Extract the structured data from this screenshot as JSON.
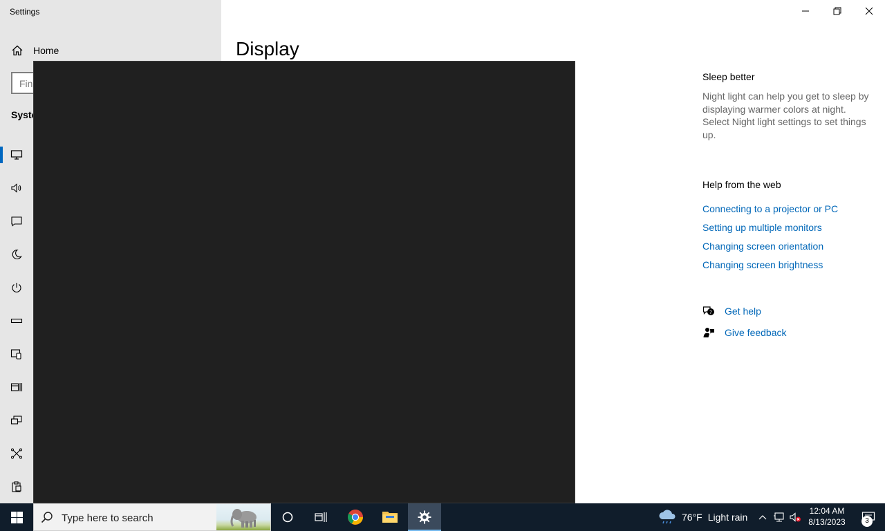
{
  "window": {
    "title": "Settings",
    "page_title": "Display"
  },
  "sidebar": {
    "home_label": "Home",
    "search_placeholder": "Find a setting",
    "visible_search_text": "Fin",
    "section_label": "Syste",
    "items": [
      {
        "icon": "display-icon",
        "active": true
      },
      {
        "icon": "sound-icon"
      },
      {
        "icon": "notifications-icon"
      },
      {
        "icon": "focus-assist-icon"
      },
      {
        "icon": "power-icon"
      },
      {
        "icon": "storage-icon"
      },
      {
        "icon": "tablet-icon"
      },
      {
        "icon": "multitasking-icon"
      },
      {
        "icon": "projecting-icon"
      },
      {
        "icon": "shared-experiences-icon"
      },
      {
        "icon": "clipboard-icon"
      }
    ]
  },
  "right_panel": {
    "sleep_heading": "Sleep better",
    "sleep_text": "Night light can help you get to sleep by displaying warmer colors at night. Select Night light settings to set things up.",
    "web_heading": "Help from the web",
    "links": [
      "Connecting to a projector or PC",
      "Setting up multiple monitors",
      "Changing screen orientation",
      "Changing screen brightness"
    ],
    "get_help": "Get help",
    "give_feedback": "Give feedback"
  },
  "taskbar": {
    "search_placeholder": "Type here to search",
    "weather_temp": "76°F",
    "weather_condition": "Light rain",
    "time": "12:04 AM",
    "date": "8/13/2023",
    "notification_count": "3"
  },
  "colors": {
    "accent": "#0067c0",
    "link": "#0067b8",
    "taskbar": "#101d2b",
    "overlay": "#202020"
  }
}
